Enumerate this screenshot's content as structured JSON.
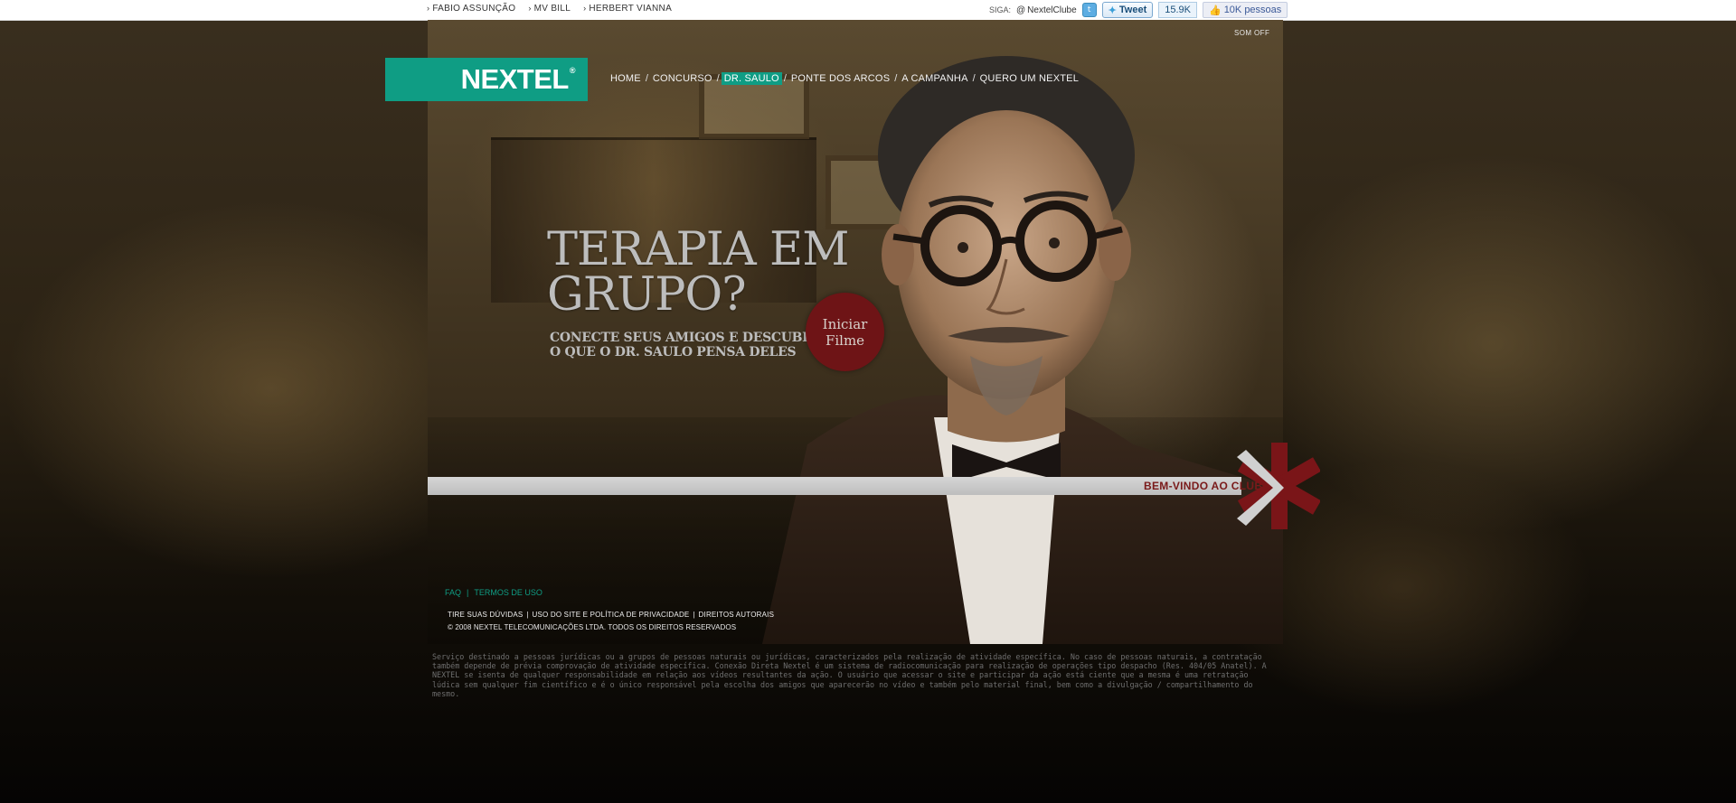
{
  "topbar": {
    "celeb_links": [
      {
        "label": "FABIO ASSUNÇÃO"
      },
      {
        "label": "MV BILL"
      },
      {
        "label": "HERBERT VIANNA"
      }
    ],
    "siga_label": "SIGA:",
    "twitter_handle": "NextelClube",
    "tweet_label": "Tweet",
    "tweet_count": "15.9K",
    "like_label": "10K pessoas"
  },
  "header": {
    "logo_text": "NEXTEL",
    "logo_mark": "®",
    "sound_toggle": "SOM OFF",
    "nav": [
      {
        "label": "HOME"
      },
      {
        "label": "CONCURSO"
      },
      {
        "label": "DR. SAULO"
      },
      {
        "label": "PONTE DOS ARCOS"
      },
      {
        "label": "A CAMPANHA"
      },
      {
        "label": "QUERO UM NEXTEL"
      }
    ]
  },
  "hero": {
    "headline_line1": "TERAPIA EM",
    "headline_line2": "GRUPO?",
    "sub_line1": "CONECTE SEUS AMIGOS E DESCUBRA",
    "sub_line2": "O QUE O DR. SAULO PENSA DELES",
    "start_line1": "Iniciar",
    "start_line2": "Filme",
    "welcome": "BEM-VINDO AO CLUBE"
  },
  "footer": {
    "faq": "FAQ",
    "terms": "TERMOS DE USO",
    "legal_links": [
      {
        "label": "TIRE SUAS DÚVIDAS"
      },
      {
        "label": "USO DO SITE E POLÍTICA DE PRIVACIDADE"
      },
      {
        "label": "DIREITOS AUTORAIS"
      }
    ],
    "copyright": "© 2008 NEXTEL TELECOMUNICAÇÕES LTDA. TODOS OS DIREITOS RESERVADOS",
    "disclaimer": "Serviço destinado a pessoas jurídicas ou a grupos de pessoas naturais ou jurídicas, caracterizados pela realização de atividade específica. No caso de pessoas naturais, a contratação também depende de prévia comprovação de atividade específica. Conexão Direta Nextel é um sistema de radiocomunicação para realização de operações tipo despacho (Res. 404/05 Anatel). A NEXTEL se isenta de qualquer responsabilidade em relação aos vídeos resultantes da ação. O usuário que acessar o site e participar da ação está ciente que a mesma é uma retratação lúdica sem qualquer fim científico e é o único responsável pela escolha dos amigos que aparecerão no vídeo e também pelo material final, bem como a divulgação / compartilhamento do mesmo."
  },
  "colors": {
    "brand_green": "#0f9d84",
    "accent_red": "#6e1416"
  }
}
